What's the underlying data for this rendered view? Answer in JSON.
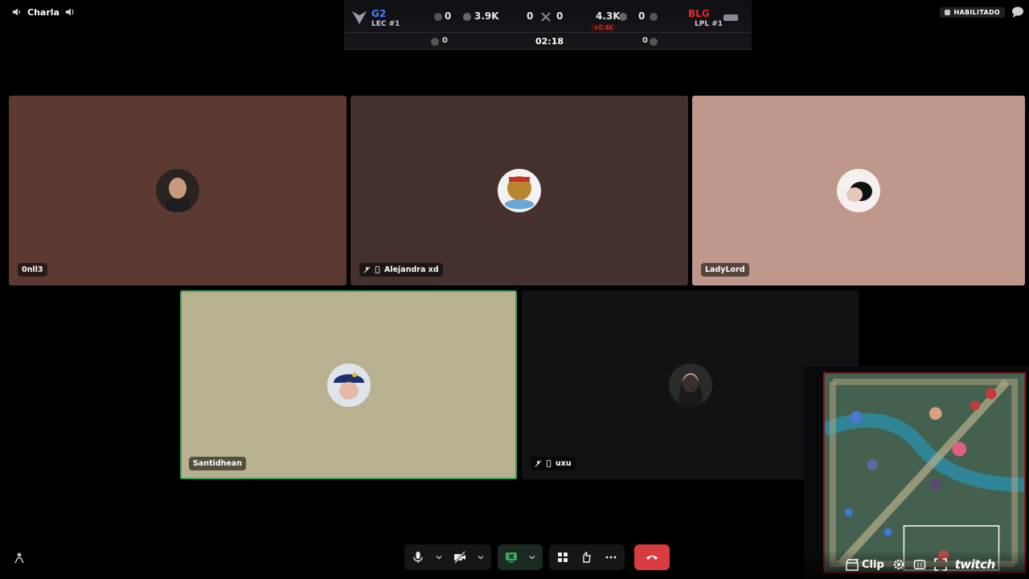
{
  "channel": {
    "name": "Charla"
  },
  "status_badge": {
    "label": "HABILITADO"
  },
  "scoreboard": {
    "left_team": "G2",
    "left_rank": "LEC #1",
    "left_towers": "0",
    "left_gold": "3.9K",
    "left_kills": "0",
    "right_kills": "0",
    "right_gold": "4.3K",
    "gold_diff": "+0.4K",
    "right_towers": "0",
    "right_team": "BLG",
    "right_rank": "LPL #1",
    "left_dragons": "0",
    "timer": "02:18",
    "right_dragons": "0"
  },
  "participants": [
    {
      "name": "0nll3",
      "bg": "#5d3a31",
      "speaking": false,
      "muted": false,
      "mobile": false
    },
    {
      "name": "Alejandra xd",
      "bg": "#43302f",
      "speaking": false,
      "muted": true,
      "mobile": true
    },
    {
      "name": "LadyLord",
      "bg": "#bf978b",
      "speaking": false,
      "muted": false,
      "mobile": false
    },
    {
      "name": "Santidhean",
      "bg": "#b8b18f",
      "speaking": true,
      "muted": false,
      "mobile": false
    },
    {
      "name": "uxu",
      "bg": "#111214",
      "speaking": false,
      "muted": true,
      "mobile": true
    }
  ],
  "stream_overlay": {
    "clip_label": "Clip",
    "brand": "twitch"
  },
  "colors": {
    "speaking_outline": "#3ba55d",
    "leave_red": "#d83c3e",
    "blue_team": "#4b7bff",
    "red_team": "#e02828"
  }
}
